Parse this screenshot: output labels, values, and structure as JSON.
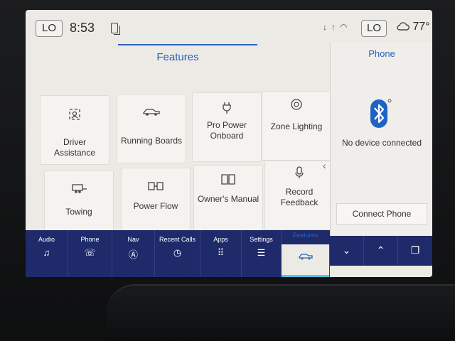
{
  "status": {
    "climate_left": "LO",
    "time": "8:53",
    "climate_right": "LO",
    "temperature": "77°"
  },
  "features": {
    "title": "Features",
    "tiles": [
      {
        "label": "Driver Assistance",
        "icon": "driver-assist-icon"
      },
      {
        "label": "Running Boards",
        "icon": "running-boards-icon"
      },
      {
        "label": "Pro Power Onboard",
        "icon": "power-plug-icon"
      },
      {
        "label": "Zone Lighting",
        "icon": "zone-lighting-icon"
      },
      {
        "label": "Towing",
        "icon": "towing-icon"
      },
      {
        "label": "Power Flow",
        "icon": "power-flow-icon"
      },
      {
        "label": "Owner's Manual",
        "icon": "manual-book-icon"
      },
      {
        "label": "Record Feedback",
        "icon": "microphone-icon"
      }
    ]
  },
  "phone_panel": {
    "title": "Phone",
    "status": "No device connected",
    "connect_label": "Connect Phone"
  },
  "nav": {
    "items": [
      {
        "label": "Audio",
        "icon": "music-note-icon"
      },
      {
        "label": "Phone",
        "icon": "phone-icon"
      },
      {
        "label": "Nav",
        "icon": "navigation-icon"
      },
      {
        "label": "Recent Calls",
        "icon": "clock-icon"
      },
      {
        "label": "Apps",
        "icon": "apps-grid-icon"
      },
      {
        "label": "Settings",
        "icon": "sliders-icon"
      },
      {
        "label": "Features",
        "icon": "truck-icon"
      }
    ],
    "active": "Features"
  },
  "colors": {
    "accent": "#2a62b8",
    "navbar": "#1f2a6b",
    "active_indicator": "#4fc6e6",
    "screen_bg": "#eceae5"
  }
}
